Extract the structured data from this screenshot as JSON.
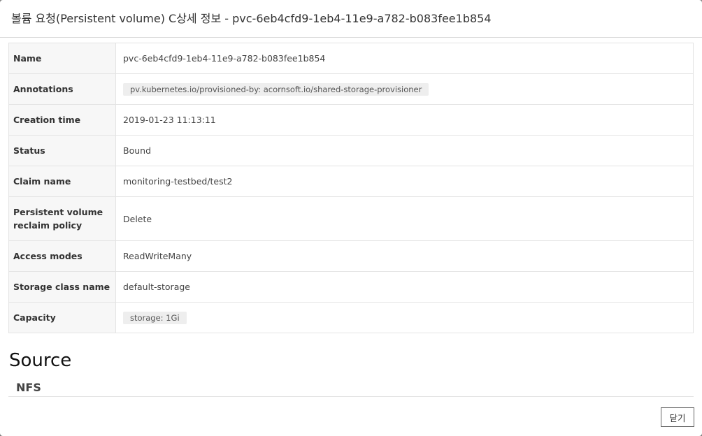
{
  "modal": {
    "title": "볼륨 요청(Persistent volume) C상세 정보 - pvc-6eb4cfd9-1eb4-11e9-a782-b083fee1b854",
    "close_label": "닫기"
  },
  "details": [
    {
      "key": "Name",
      "value": "pvc-6eb4cfd9-1eb4-11e9-a782-b083fee1b854",
      "is_tag": false
    },
    {
      "key": "Annotations",
      "value": "pv.kubernetes.io/provisioned-by: acornsoft.io/shared-storage-provisioner",
      "is_tag": true
    },
    {
      "key": "Creation time",
      "value": "2019-01-23 11:13:11",
      "is_tag": false
    },
    {
      "key": "Status",
      "value": "Bound",
      "is_tag": false
    },
    {
      "key": "Claim name",
      "value": "monitoring-testbed/test2",
      "is_tag": false
    },
    {
      "key": "Persistent volume reclaim policy",
      "value": "Delete",
      "is_tag": false
    },
    {
      "key": "Access modes",
      "value": "ReadWriteMany",
      "is_tag": false
    },
    {
      "key": "Storage class name",
      "value": "default-storage",
      "is_tag": false
    },
    {
      "key": "Capacity",
      "value": "storage: 1Gi",
      "is_tag": true
    }
  ],
  "source": {
    "heading": "Source",
    "type": "NFS"
  }
}
